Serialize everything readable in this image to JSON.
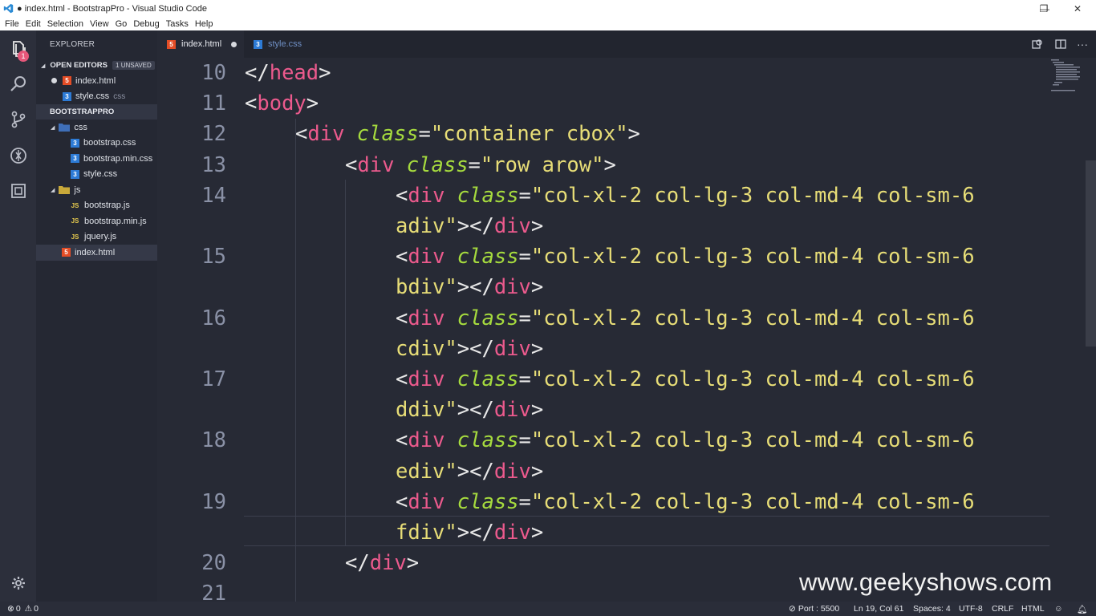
{
  "window": {
    "title": "● index.html - BootstrapPro - Visual Studio Code",
    "minimize": "—",
    "restore": "❐",
    "close": "✕"
  },
  "menu": [
    "File",
    "Edit",
    "Selection",
    "View",
    "Go",
    "Debug",
    "Tasks",
    "Help"
  ],
  "activity": {
    "explorer_badge": "1",
    "icons": [
      "files-icon",
      "search-icon",
      "source-control-icon",
      "debug-icon",
      "extensions-icon",
      "gear-icon"
    ]
  },
  "sidebar": {
    "header": "EXPLORER",
    "open_editors": {
      "label": "OPEN EDITORS",
      "badge": "1 UNSAVED",
      "items": [
        {
          "name": "index.html",
          "type": "html",
          "dirty": true
        },
        {
          "name": "style.css",
          "type": "css",
          "folder": "css"
        }
      ]
    },
    "project": {
      "label": "BOOTSTRAPPRO",
      "folders": [
        {
          "name": "css",
          "files": [
            "bootstrap.css",
            "bootstrap.min.css",
            "style.css"
          ]
        },
        {
          "name": "js",
          "files": [
            "bootstrap.js",
            "bootstrap.min.js",
            "jquery.js"
          ]
        }
      ],
      "root_files": [
        "index.html"
      ]
    },
    "icon_labels": {
      "js": "JS",
      "html": "5",
      "css": "3"
    }
  },
  "tabs": [
    {
      "label": "index.html",
      "type": "html",
      "active": true,
      "modified": true
    },
    {
      "label": "style.css",
      "type": "css",
      "active": false
    }
  ],
  "editor": {
    "lines": [
      {
        "num": "10",
        "indent": 0,
        "tokens": [
          [
            "p",
            "</"
          ],
          [
            "t",
            "head"
          ],
          [
            "p",
            ">"
          ]
        ]
      },
      {
        "num": "11",
        "indent": 0,
        "tokens": [
          [
            "p",
            "<"
          ],
          [
            "t",
            "body"
          ],
          [
            "p",
            ">"
          ]
        ]
      },
      {
        "num": "12",
        "indent": 1,
        "tokens": [
          [
            "p",
            "<"
          ],
          [
            "t",
            "div"
          ],
          [
            "p",
            " "
          ],
          [
            "a",
            "class"
          ],
          [
            "p",
            "="
          ],
          [
            "s",
            "\"container cbox\""
          ],
          [
            "p",
            ">"
          ]
        ]
      },
      {
        "num": "13",
        "indent": 2,
        "tokens": [
          [
            "p",
            "<"
          ],
          [
            "t",
            "div"
          ],
          [
            "p",
            " "
          ],
          [
            "a",
            "class"
          ],
          [
            "p",
            "="
          ],
          [
            "s",
            "\"row arow\""
          ],
          [
            "p",
            ">"
          ]
        ]
      },
      {
        "num": "14",
        "indent": 3,
        "tokens": [
          [
            "p",
            "<"
          ],
          [
            "t",
            "div"
          ],
          [
            "p",
            " "
          ],
          [
            "a",
            "class"
          ],
          [
            "p",
            "="
          ],
          [
            "s",
            "\"col-xl-2 col-lg-3 col-md-4 col-sm-6"
          ]
        ]
      },
      {
        "num": "",
        "indent": 3,
        "tokens": [
          [
            "s",
            "adiv\""
          ],
          [
            "p",
            "></"
          ],
          [
            "t",
            "div"
          ],
          [
            "p",
            ">"
          ]
        ]
      },
      {
        "num": "15",
        "indent": 3,
        "tokens": [
          [
            "p",
            "<"
          ],
          [
            "t",
            "div"
          ],
          [
            "p",
            " "
          ],
          [
            "a",
            "class"
          ],
          [
            "p",
            "="
          ],
          [
            "s",
            "\"col-xl-2 col-lg-3 col-md-4 col-sm-6"
          ]
        ]
      },
      {
        "num": "",
        "indent": 3,
        "tokens": [
          [
            "s",
            "bdiv\""
          ],
          [
            "p",
            "></"
          ],
          [
            "t",
            "div"
          ],
          [
            "p",
            ">"
          ]
        ]
      },
      {
        "num": "16",
        "indent": 3,
        "tokens": [
          [
            "p",
            "<"
          ],
          [
            "t",
            "div"
          ],
          [
            "p",
            " "
          ],
          [
            "a",
            "class"
          ],
          [
            "p",
            "="
          ],
          [
            "s",
            "\"col-xl-2 col-lg-3 col-md-4 col-sm-6"
          ]
        ]
      },
      {
        "num": "",
        "indent": 3,
        "tokens": [
          [
            "s",
            "cdiv\""
          ],
          [
            "p",
            "></"
          ],
          [
            "t",
            "div"
          ],
          [
            "p",
            ">"
          ]
        ]
      },
      {
        "num": "17",
        "indent": 3,
        "tokens": [
          [
            "p",
            "<"
          ],
          [
            "t",
            "div"
          ],
          [
            "p",
            " "
          ],
          [
            "a",
            "class"
          ],
          [
            "p",
            "="
          ],
          [
            "s",
            "\"col-xl-2 col-lg-3 col-md-4 col-sm-6"
          ]
        ]
      },
      {
        "num": "",
        "indent": 3,
        "tokens": [
          [
            "s",
            "ddiv\""
          ],
          [
            "p",
            "></"
          ],
          [
            "t",
            "div"
          ],
          [
            "p",
            ">"
          ]
        ]
      },
      {
        "num": "18",
        "indent": 3,
        "tokens": [
          [
            "p",
            "<"
          ],
          [
            "t",
            "div"
          ],
          [
            "p",
            " "
          ],
          [
            "a",
            "class"
          ],
          [
            "p",
            "="
          ],
          [
            "s",
            "\"col-xl-2 col-lg-3 col-md-4 col-sm-6"
          ]
        ]
      },
      {
        "num": "",
        "indent": 3,
        "tokens": [
          [
            "s",
            "ediv\""
          ],
          [
            "p",
            "></"
          ],
          [
            "t",
            "div"
          ],
          [
            "p",
            ">"
          ]
        ]
      },
      {
        "num": "19",
        "indent": 3,
        "tokens": [
          [
            "p",
            "<"
          ],
          [
            "t",
            "div"
          ],
          [
            "p",
            " "
          ],
          [
            "a",
            "class"
          ],
          [
            "p",
            "="
          ],
          [
            "s",
            "\"col-xl-2 col-lg-3 col-md-4 col-sm-6"
          ]
        ]
      },
      {
        "num": "",
        "indent": 3,
        "tokens": [
          [
            "s",
            "fdiv\""
          ],
          [
            "p",
            "></"
          ],
          [
            "t",
            "div"
          ],
          [
            "p",
            ">"
          ]
        ]
      },
      {
        "num": "20",
        "indent": 2,
        "tokens": [
          [
            "p",
            "</"
          ],
          [
            "t",
            "div"
          ],
          [
            "p",
            ">"
          ]
        ]
      },
      {
        "num": "21",
        "indent": 0,
        "tokens": []
      }
    ]
  },
  "watermark": "www.geekyshows.com",
  "status": {
    "errors": "0",
    "warnings": "0",
    "port": "Port : 5500",
    "position": "Ln 19, Col 61",
    "spaces": "Spaces: 4",
    "encoding": "UTF-8",
    "eol": "CRLF",
    "language": "HTML"
  },
  "colors": {
    "tag": "#ec5a8d",
    "attr": "#a6db3e",
    "string": "#e7dd77",
    "background": "#272a35"
  }
}
